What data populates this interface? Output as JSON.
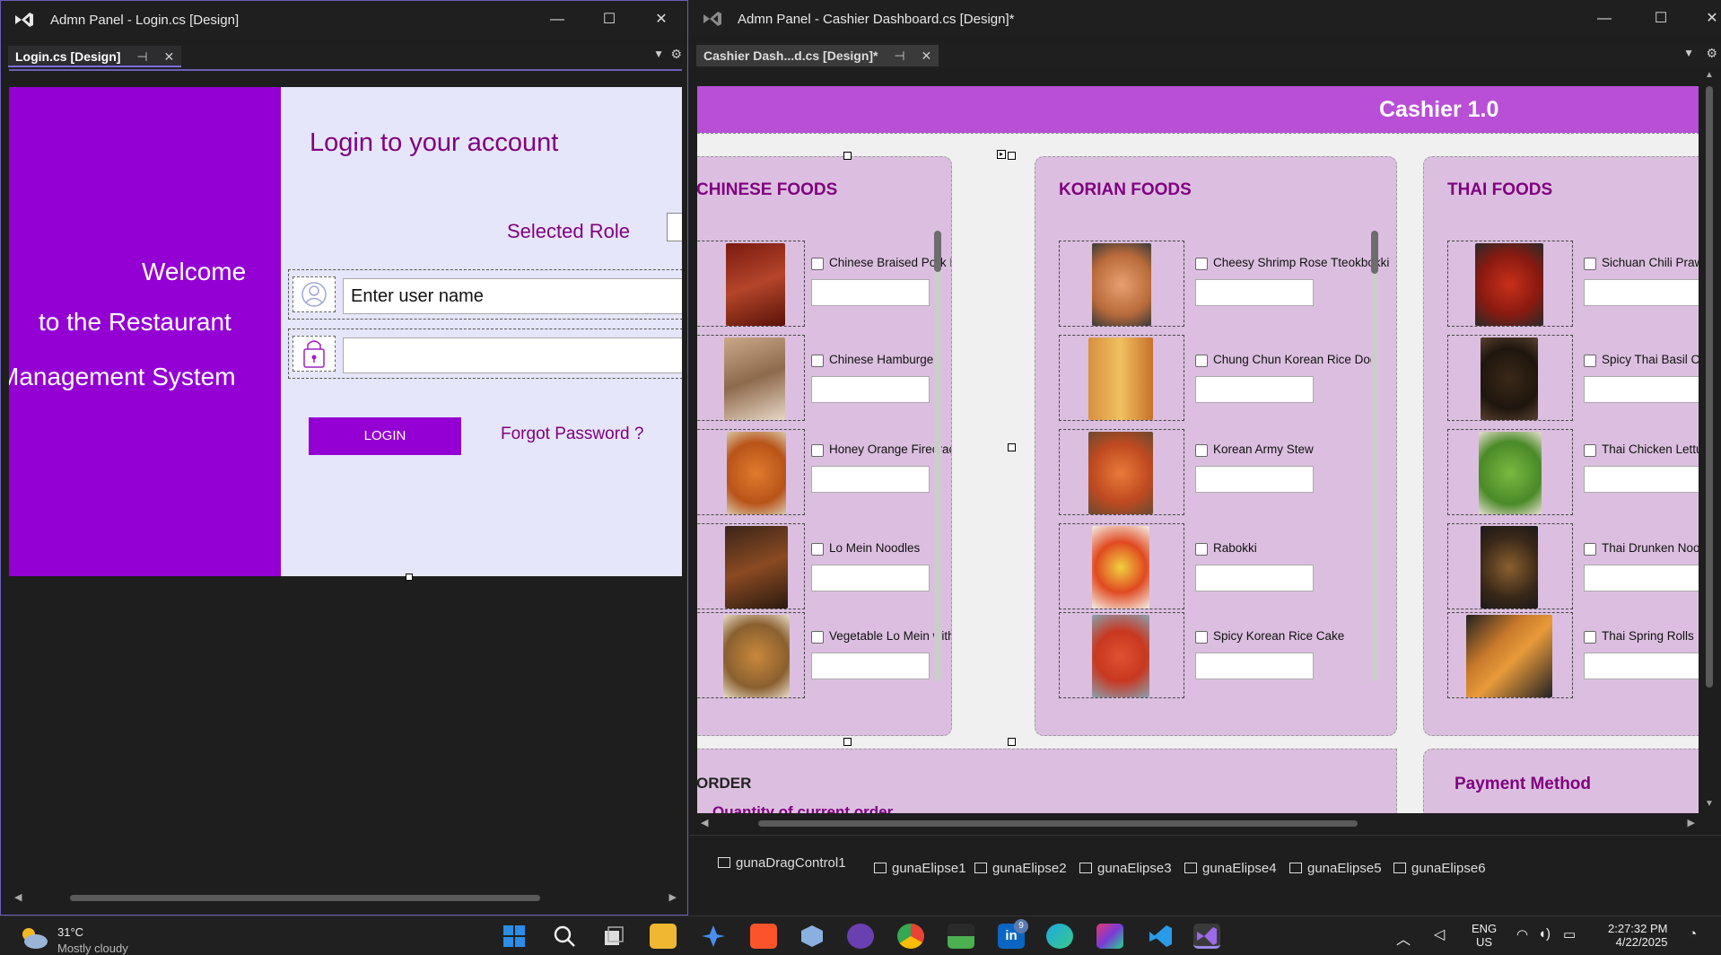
{
  "window_left": {
    "title": "Admn Panel - Login.cs [Design]",
    "tab_label": "Login.cs [Design]",
    "form": {
      "heading": "Login to your account",
      "role_label": "Selected Role",
      "welcome_lines": [
        "Welcome",
        "to the Restaurant",
        "Management System"
      ],
      "username_value": "Enter user name",
      "password_value": "",
      "login_button": "LOGIN",
      "forgot_link": "Forgot Password ?"
    }
  },
  "window_right": {
    "title": "Admn Panel - Cashier Dashboard.cs [Design]*",
    "tab_label": "Cashier Dash...d.cs [Design]*",
    "header_title": "Cashier 1.0",
    "panels": [
      {
        "title": "CHINESE FOODS",
        "items": [
          "Chinese Braised Pork Belly",
          "Chinese Hamburger",
          "Honey Orange Firecracker",
          "Lo Mein Noodles",
          "Vegetable Lo Mein with Tofu"
        ]
      },
      {
        "title": "KORIAN FOODS",
        "items": [
          "Cheesy Shrimp Rose Tteokbokki",
          "Chung Chun Korean Rice Dog",
          "Korean Army Stew",
          "Rabokki",
          "Spicy Korean Rice Cake"
        ]
      },
      {
        "title": "THAI FOODS",
        "items": [
          "Sichuan Chili Praw",
          "Spicy Thai Basil Ch",
          "Thai Chicken Lettu",
          "Thai Drunken Noo",
          "Thai Spring Rolls"
        ]
      }
    ],
    "order_title": "ORDER",
    "order_subtitle": "Quantity of current order",
    "payment_title": "Payment Method",
    "components": [
      "gunaDragControl1",
      "gunaElipse1",
      "gunaElipse2",
      "gunaElipse3",
      "gunaElipse4",
      "gunaElipse5",
      "gunaElipse6"
    ]
  },
  "taskbar": {
    "weather_temp": "31°C",
    "weather_desc": "Mostly cloudy",
    "lang_line1": "ENG",
    "lang_line2": "US",
    "time": "2:27:32 PM",
    "date": "4/22/2025",
    "linkedin_badge": "9",
    "icons": [
      "windows-start-icon",
      "search-icon",
      "task-view-icon",
      "file-explorer-icon",
      "copilot-icon",
      "brave-icon",
      "box-app-icon",
      "github-desktop-icon",
      "chrome-icon",
      "terminal-app-icon",
      "linkedin-icon",
      "edge-icon",
      "jetbrains-icon",
      "vscode-icon",
      "visual-studio-icon"
    ]
  },
  "colors": {
    "sidebar_purple": "#9400d3",
    "header_purple": "#b84fd6",
    "panel_lilac": "#dcbfe0",
    "form_lavender": "#e6e6fa",
    "text_purple": "#800080"
  }
}
